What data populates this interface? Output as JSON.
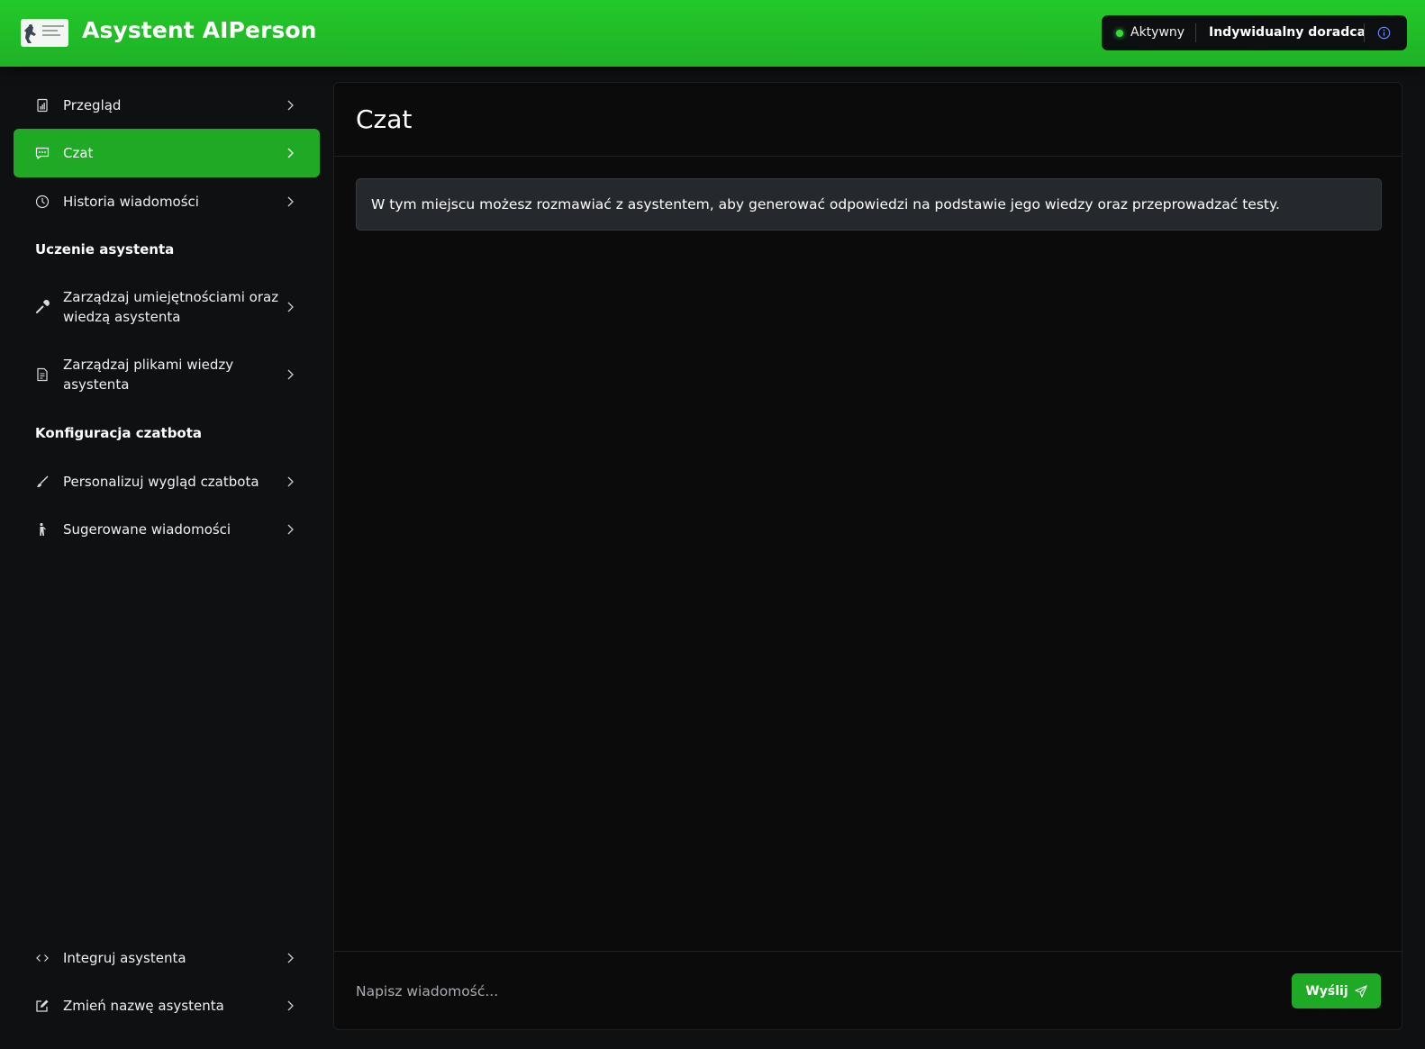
{
  "header": {
    "app_title": "Asystent AIPerson",
    "status": "Aktywny",
    "plan": "Indywidualny doradca",
    "colors": {
      "brand": "#22c42a",
      "status_dot": "#2fe03a",
      "info_icon": "#6b8cff"
    }
  },
  "sidebar": {
    "items_top": [
      {
        "label": "Przegląd",
        "icon": "report-icon"
      },
      {
        "label": "Czat",
        "icon": "chat-icon",
        "active": true
      },
      {
        "label": "Historia wiadomości",
        "icon": "clock-icon"
      }
    ],
    "section_training": "Uczenie asystenta",
    "items_training": [
      {
        "label": "Zarządzaj umiejętnościami oraz wiedzą asystenta",
        "icon": "wrench-icon"
      },
      {
        "label": "Zarządzaj plikami wiedzy asystenta",
        "icon": "document-icon"
      }
    ],
    "section_config": "Konfiguracja czatbota",
    "items_config": [
      {
        "label": "Personalizuj wygląd czatbota",
        "icon": "brush-icon"
      },
      {
        "label": "Sugerowane wiadomości",
        "icon": "person-icon"
      }
    ],
    "items_bottom": [
      {
        "label": "Integruj asystenta",
        "icon": "code-icon"
      },
      {
        "label": "Zmień nazwę asystenta",
        "icon": "edit-icon"
      }
    ]
  },
  "main": {
    "title": "Czat",
    "info": "W tym miejscu możesz rozmawiać z asystentem, aby generować odpowiedzi na podstawie jego wiedzy oraz przeprowadzać testy.",
    "input_placeholder": "Napisz wiadomość...",
    "send_label": "Wyślij"
  }
}
